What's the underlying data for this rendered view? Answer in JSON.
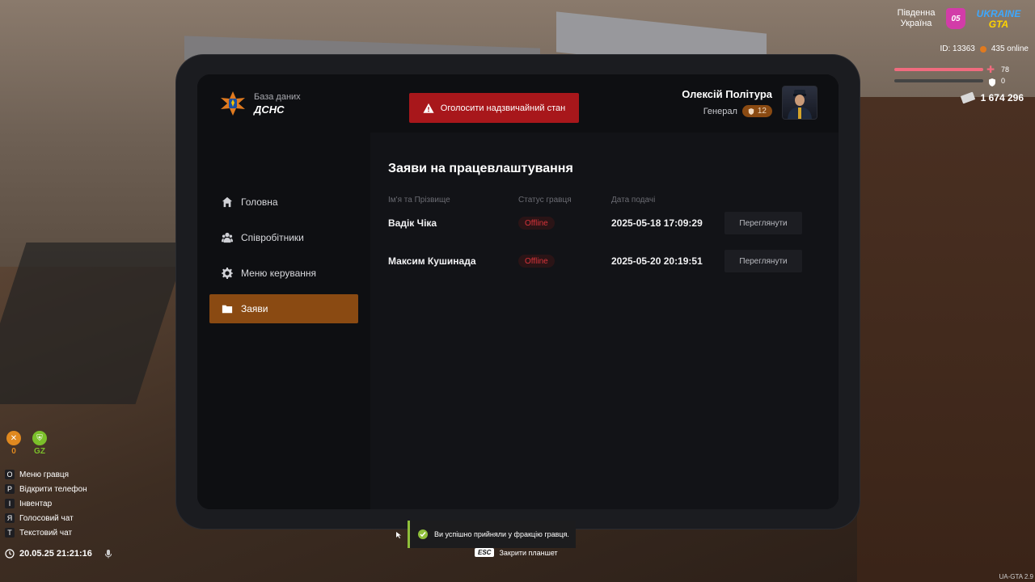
{
  "app": {
    "brand_subtitle": "База даних",
    "brand_title": "ДСНС"
  },
  "sidebar": {
    "items": [
      {
        "label": "Головна",
        "icon": "home-icon",
        "active": false
      },
      {
        "label": "Співробітники",
        "icon": "users-icon",
        "active": false
      },
      {
        "label": "Меню керування",
        "icon": "gear-icon",
        "active": false
      },
      {
        "label": "Заяви",
        "icon": "folder-icon",
        "active": true
      }
    ]
  },
  "header": {
    "alarm_button": "Оголосити надзвичайний стан",
    "user_name": "Олексій Політура",
    "user_rank": "Генерал",
    "rank_level": "12"
  },
  "main": {
    "title": "Заяви на працевлаштування",
    "columns": [
      "Ім'я та Прізвище",
      "Статус гравця",
      "Дата подачі"
    ],
    "rows": [
      {
        "name": "Вадік Чіка",
        "status": "Offline",
        "date": "2025-05-18 17:09:29",
        "action": "Переглянути"
      },
      {
        "name": "Максим Кушинада",
        "status": "Offline",
        "date": "2025-05-20 20:19:51",
        "action": "Переглянути"
      }
    ]
  },
  "hud": {
    "region": "Південна Україна",
    "region_code": "05",
    "server_logo_line1": "UKRAINE",
    "server_logo_line2": "GTA",
    "player_id": "ID: 13363",
    "online": "435 online",
    "health": "78",
    "armor": "0",
    "money": "1 674 296",
    "stat_1_value": "0",
    "stat_2_value": "GZ",
    "keys": [
      {
        "key": "O",
        "label": "Меню гравця"
      },
      {
        "key": "P",
        "label": "Відкрити телефон"
      },
      {
        "key": "I",
        "label": "Інвентар"
      },
      {
        "key": "Я",
        "label": "Голосовий чат"
      },
      {
        "key": "T",
        "label": "Текстовий чат"
      }
    ],
    "clock": "20.05.25 21:21:16",
    "toast": "Ви успішно прийняли у фракцію гравця.",
    "esc_key": "ESC",
    "esc_label": "Закрити планшет",
    "version": "UA-GTA 2.9"
  },
  "colors": {
    "accent": "#8a4a12",
    "danger": "#a8171b",
    "status_offline": "#d7333a",
    "success": "#8fbf3a"
  }
}
